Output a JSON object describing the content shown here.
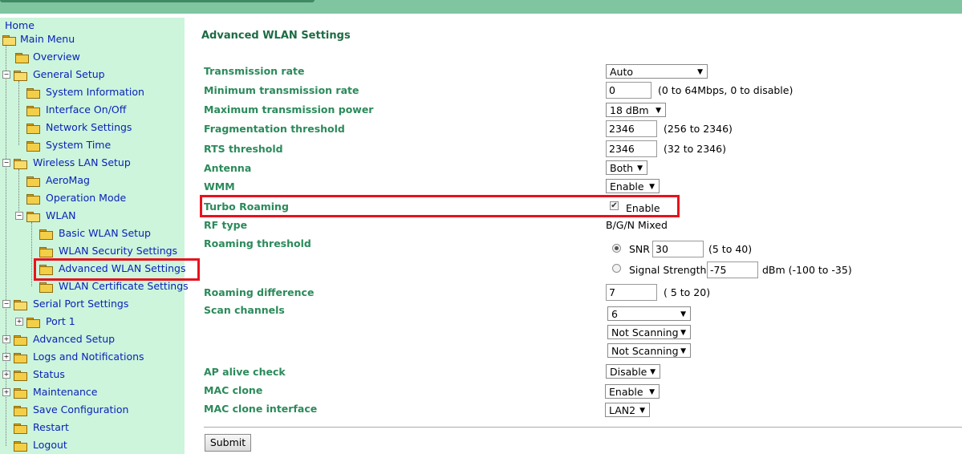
{
  "sidebar": {
    "home": "Home",
    "main_menu": "Main Menu",
    "items": {
      "overview": "Overview",
      "general_setup": "General Setup",
      "system_information": "System Information",
      "interface_onoff": "Interface On/Off",
      "network_settings": "Network Settings",
      "system_time": "System Time",
      "wireless_lan_setup": "Wireless LAN Setup",
      "aeromag": "AeroMag",
      "operation_mode": "Operation Mode",
      "wlan": "WLAN",
      "basic_wlan_setup": "Basic WLAN Setup",
      "wlan_security_settings": "WLAN Security Settings",
      "advanced_wlan_settings": "Advanced WLAN Settings",
      "wlan_certificate_settings": "WLAN Certificate Settings",
      "serial_port_settings": "Serial Port Settings",
      "port1": "Port 1",
      "advanced_setup": "Advanced Setup",
      "logs_notifications": "Logs and Notifications",
      "status": "Status",
      "maintenance": "Maintenance",
      "save_configuration": "Save Configuration",
      "restart": "Restart",
      "logout": "Logout"
    }
  },
  "main": {
    "title": "Advanced WLAN Settings",
    "labels": {
      "transmission_rate": "Transmission rate",
      "min_transmission_rate": "Minimum transmission rate",
      "max_transmission_power": "Maximum transmission power",
      "fragmentation_threshold": "Fragmentation threshold",
      "rts_threshold": "RTS threshold",
      "antenna": "Antenna",
      "wmm": "WMM",
      "turbo_roaming": "Turbo Roaming",
      "rf_type": "RF type",
      "roaming_threshold": "Roaming threshold",
      "roaming_difference": "Roaming difference",
      "scan_channels": "Scan channels",
      "ap_alive_check": "AP alive check",
      "mac_clone": "MAC clone",
      "mac_clone_interface": "MAC clone interface"
    },
    "values": {
      "transmission_rate": "Auto",
      "min_transmission_rate": "0",
      "min_transmission_rate_hint": "(0 to 64Mbps, 0 to disable)",
      "max_transmission_power": "18 dBm",
      "fragmentation_threshold": "2346",
      "fragmentation_hint": "(256 to 2346)",
      "rts_threshold": "2346",
      "rts_hint": "(32 to 2346)",
      "antenna": "Both",
      "wmm": "Enable",
      "turbo_roaming_check": "Enable",
      "rf_type": "B/G/N Mixed",
      "snr_label": "SNR",
      "snr_value": "30",
      "snr_hint": "(5 to 40)",
      "signal_label": "Signal Strength",
      "signal_value": "-75",
      "signal_hint": "dBm (-100 to -35)",
      "roaming_difference": "7",
      "roaming_difference_hint": "( 5 to 20)",
      "scan_channel_1": "6",
      "scan_channel_2": "Not Scanning",
      "scan_channel_3": "Not Scanning",
      "ap_alive_check": "Disable",
      "mac_clone": "Enable",
      "mac_clone_interface": "LAN2"
    },
    "submit": "Submit"
  },
  "colors": {
    "topbar": "#7fc6a0",
    "sidebar_bg": "#ccf5dc",
    "label_green": "#2b8a5a",
    "link_blue": "#0b22b8",
    "highlight_red": "#e8121d"
  }
}
